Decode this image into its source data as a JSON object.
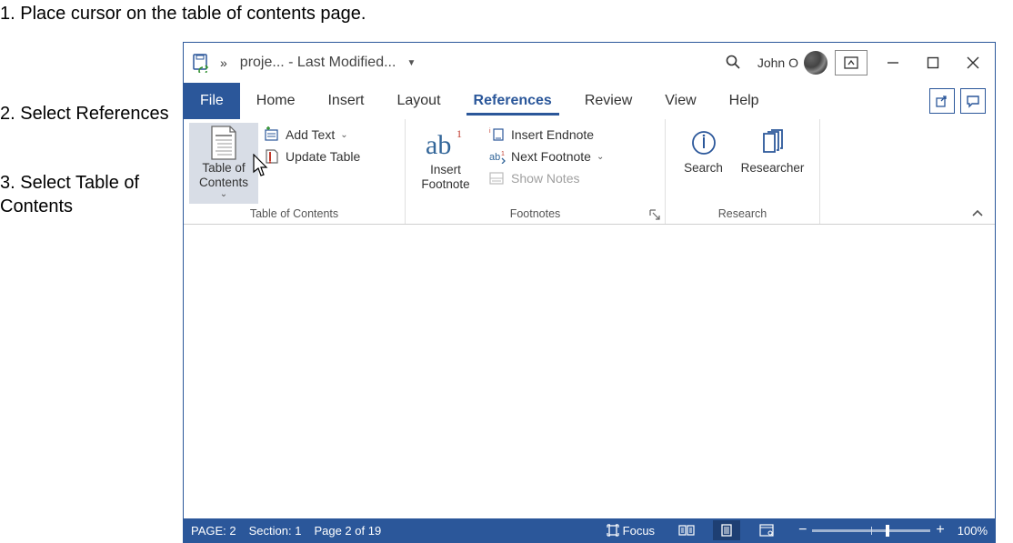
{
  "instructions": {
    "step1": "1. Place cursor on the table of contents page.",
    "step2": "2. Select References",
    "step3": "3. Select Table of Contents"
  },
  "titlebar": {
    "doc_title": "proje... - Last Modified...",
    "user_name": "John O"
  },
  "tabs": {
    "file": "File",
    "home": "Home",
    "insert": "Insert",
    "layout": "Layout",
    "references": "References",
    "review": "Review",
    "view": "View",
    "help": "Help"
  },
  "ribbon": {
    "toc_group": {
      "label": "Table of Contents",
      "toc_btn": "Table of Contents",
      "add_text": "Add Text",
      "update_table": "Update Table"
    },
    "footnotes_group": {
      "label": "Footnotes",
      "insert_footnote": "Insert Footnote",
      "insert_endnote": "Insert Endnote",
      "next_footnote": "Next Footnote",
      "show_notes": "Show Notes"
    },
    "research_group": {
      "label": "Research",
      "search": "Search",
      "researcher": "Researcher"
    }
  },
  "status": {
    "page": "PAGE: 2",
    "section": "Section: 1",
    "page_of": "Page 2 of 19",
    "focus": "Focus",
    "zoom_pct": "100%"
  }
}
